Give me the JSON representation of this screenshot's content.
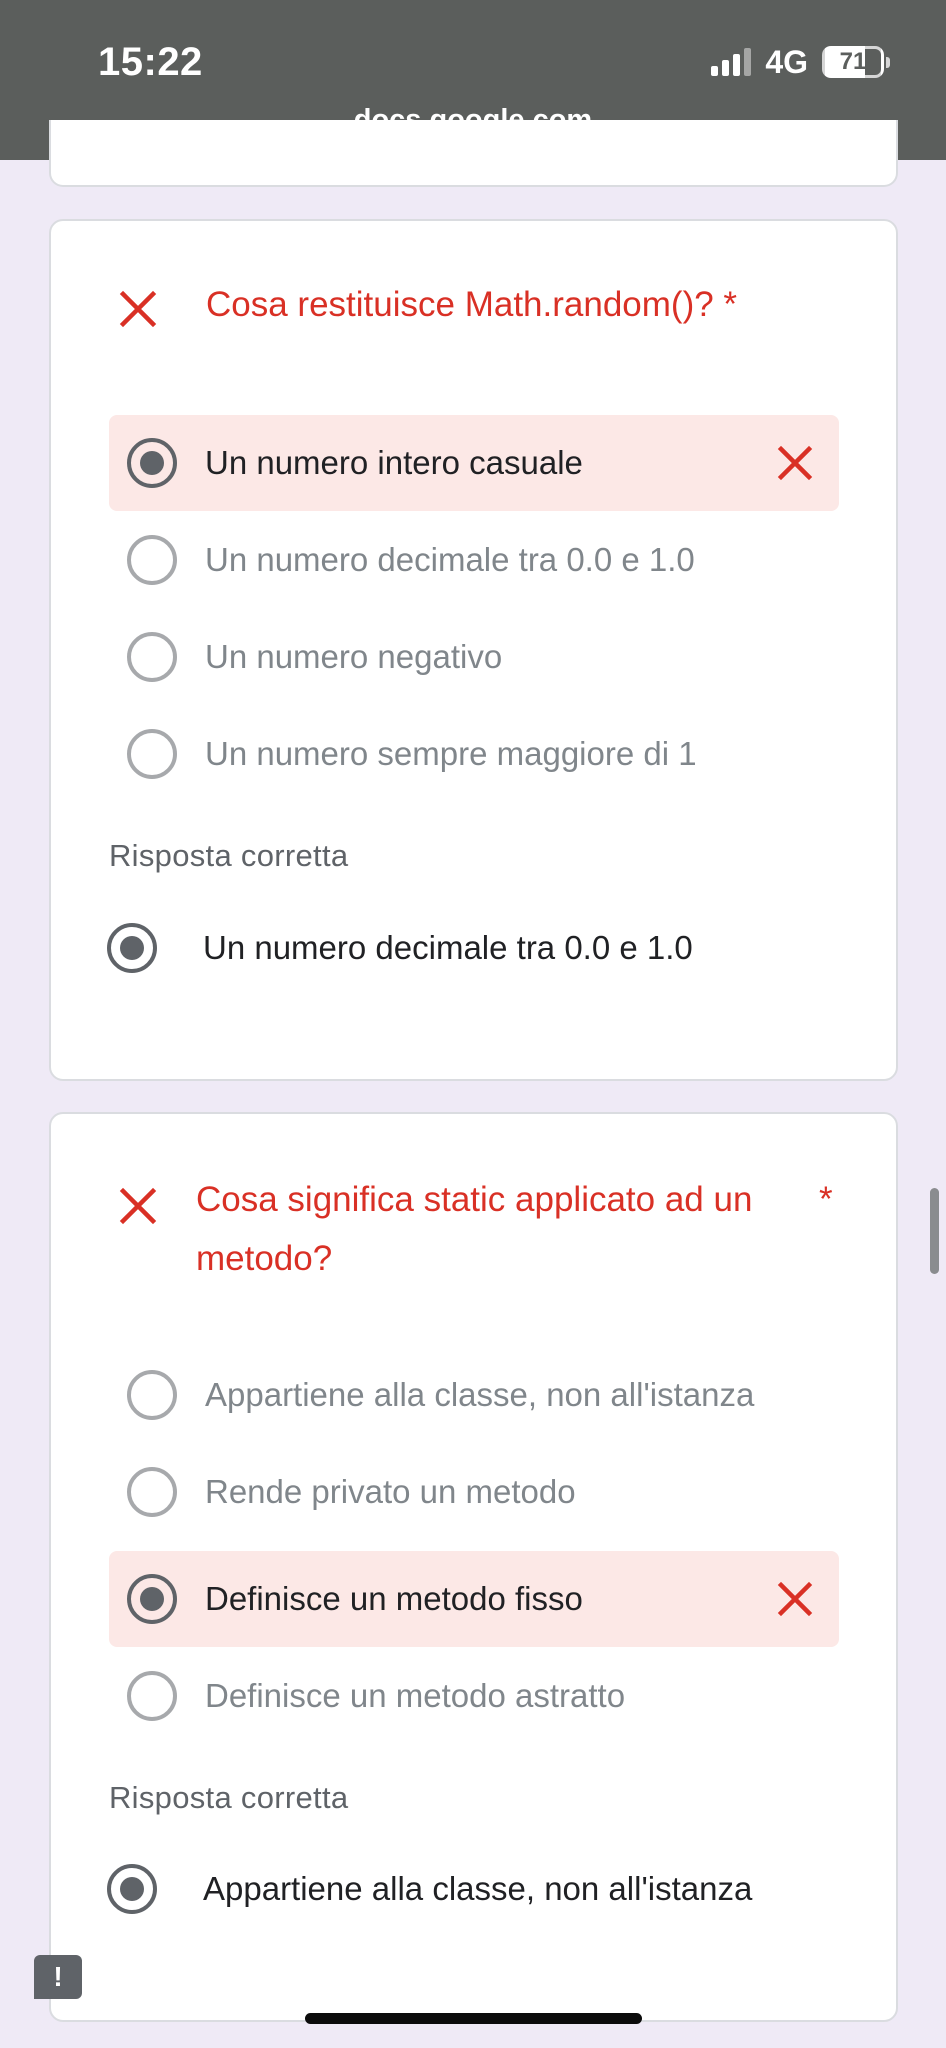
{
  "status_bar": {
    "time": "15:22",
    "network": "4G",
    "battery": "71",
    "battery_level_percent": 71
  },
  "browser": {
    "url": "docs.google.com"
  },
  "questions": [
    {
      "title": "Cosa restituisce Math.random()? *",
      "status_icon": "close-icon",
      "options": [
        {
          "label": "Un numero intero casuale",
          "selected": true,
          "wrong": true
        },
        {
          "label": "Un numero decimale tra 0.0 e 1.0",
          "selected": false
        },
        {
          "label": "Un numero negativo",
          "selected": false
        },
        {
          "label": "Un numero sempre maggiore di 1",
          "selected": false
        }
      ],
      "correct_heading": "Risposta corretta",
      "correct_answer": "Un numero decimale tra 0.0 e 1.0"
    },
    {
      "title": "Cosa significa static applicato ad un metodo?",
      "required_mark": "*",
      "status_icon": "close-icon",
      "options": [
        {
          "label": "Appartiene alla classe, non all'istanza",
          "selected": false
        },
        {
          "label": "Rende privato un metodo",
          "selected": false
        },
        {
          "label": "Definisce un metodo fisso",
          "selected": true,
          "wrong": true
        },
        {
          "label": "Definisce un metodo astratto",
          "selected": false
        }
      ],
      "correct_heading": "Risposta corretta",
      "correct_answer": "Appartiene alla classe, non all'istanza"
    }
  ],
  "feedback_button": {
    "label": "!"
  },
  "colors": {
    "error_red": "#d93025",
    "wrong_option_bg": "#fce8e6",
    "page_bg": "#efeaf6",
    "status_bar_bg": "#5b5e5c"
  }
}
